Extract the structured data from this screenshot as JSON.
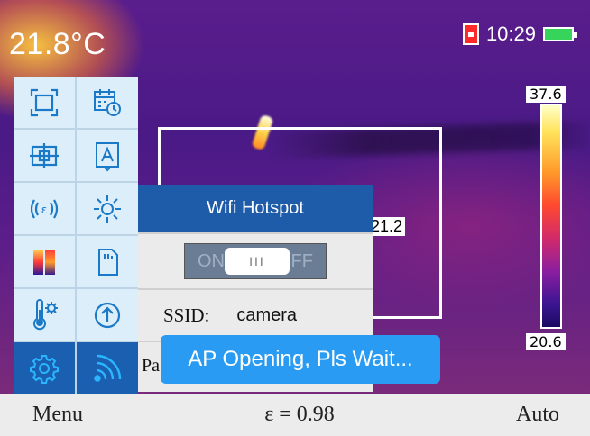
{
  "header": {
    "temperature": "21.8°C",
    "time": "10:29",
    "sd_icon": "sd-card-icon",
    "battery_icon": "battery-icon"
  },
  "scale": {
    "max": "37.6",
    "min": "20.6"
  },
  "roi": {
    "temperature": "21.2"
  },
  "menu": {
    "icons": [
      "area-measure-icon",
      "calendar-clock-icon",
      "center-point-icon",
      "text-annotation-icon",
      "emissivity-icon",
      "brightness-icon",
      "palette-icon",
      "storage-card-icon",
      "temperature-settings-icon",
      "upload-icon",
      "settings-gear-icon",
      "wifi-icon"
    ]
  },
  "popup": {
    "title": "Wifi Hotspot",
    "toggle": {
      "on_label": "ON",
      "off_label": "OFF",
      "knob": "III",
      "state": "off"
    },
    "ssid_label": "SSID:",
    "ssid_value": "camera",
    "password_label_partial": "Pa"
  },
  "toast": {
    "message": "AP Opening, Pls Wait..."
  },
  "bottom_bar": {
    "left": "Menu",
    "center": "ε = 0.98",
    "right": "Auto"
  }
}
